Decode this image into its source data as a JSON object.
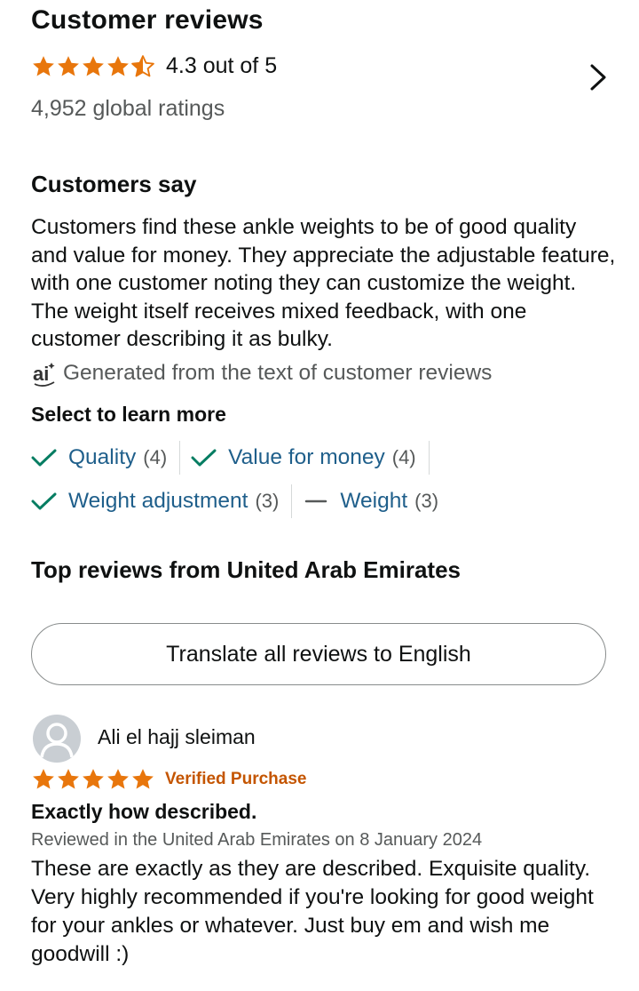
{
  "reviews_header": {
    "title": "Customer reviews",
    "average_rating": 4.3,
    "rating_text": "4.3 out of 5",
    "global_ratings": "4,952 global ratings"
  },
  "customers_say": {
    "title": "Customers say",
    "summary": "Customers find these ankle weights to be of good quality and value for money. They appreciate the adjustable feature, with one customer noting they can customize the weight. The weight itself receives mixed feedback, with one customer describing it as bulky.",
    "ai_note": "Generated from the text of customer reviews",
    "ai_icon": "ai-icon",
    "select_label": "Select to learn more",
    "chips": [
      {
        "label": "Quality",
        "count": "(4)",
        "sentiment": "positive",
        "icon": "check-icon"
      },
      {
        "label": "Value for money",
        "count": "(4)",
        "sentiment": "positive",
        "icon": "check-icon"
      },
      {
        "label": "Weight adjustment",
        "count": "(3)",
        "sentiment": "positive",
        "icon": "check-icon"
      },
      {
        "label": "Weight",
        "count": "(3)",
        "sentiment": "mixed",
        "icon": "dash-icon"
      }
    ]
  },
  "top_reviews": {
    "title": "Top reviews from United Arab Emirates",
    "translate_label": "Translate all reviews to English",
    "review": {
      "reviewer": "Ali el hajj sleiman",
      "rating": 5,
      "verified": "Verified Purchase",
      "headline": "Exactly how described.",
      "meta": "Reviewed in the United Arab Emirates on 8 January 2024",
      "body": "These are exactly as they are described. Exquisite quality. Very highly recommended if you're looking for good weight for your ankles or whatever. Just buy em and wish me goodwill :)"
    }
  },
  "colors": {
    "star": "#e8760c",
    "link": "#1f5f8b",
    "check": "#067d62",
    "verified": "#c45500"
  }
}
